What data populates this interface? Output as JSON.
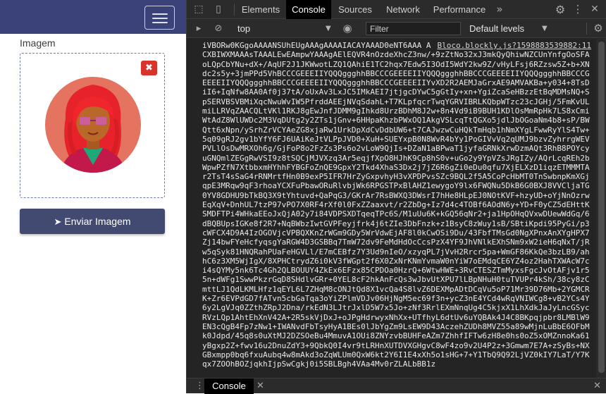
{
  "app": {
    "image_label": "Imagem",
    "remove_glyph": "✖",
    "send_button_label": "Enviar Imagem",
    "send_icon": "paper-plane-icon",
    "navbar_color": "#3a4279",
    "button_color": "#434a72",
    "remove_color": "#d9342b"
  },
  "devtools": {
    "tabs": [
      "Elements",
      "Console",
      "Sources",
      "Network",
      "Performance"
    ],
    "active_tab": "Console",
    "more_tabs_glyph": "»",
    "context": "top",
    "filter_placeholder": "Filter",
    "levels": "Default levels",
    "drawer_tab": "Console",
    "log": {
      "source": "Bloco.blockly.js?1598883539882:11",
      "text": "iVBORw0KGgoAAAANSUhEUgAAAgAAAAIACAYAAAD0eNT6AAA ACXBIWXMAAAsTAAALEwEAmpwYAAAgAElEQVR4nOzdeXhcZ3nw/+9zZtNo32xJ3mkQyQhiwNZCUnYnfgOoSFAoLQpCbYNu+dX+/AqUF2J1JKWwotLZQ1QAhiE1TC2hqx7Edw5I3OdI5WdY2kw9Z/vHyLFsj6RZzsw5Z+b+XNdc2s5y+3jmPPd5VhBCCCGEEEIIYQQQggghhBBCCCGEEEEIIYQQQggghhBBCCCGEEEEIIYQQQggghhBBCCCGEEEEIIYQQQggghhBBCCCGEEEEIIYQQQggghhBBCCCGEEEEIIYvXD2R2AEMJaGrxAE9AMVAKBa+y034+8TsDiI6+IqNfw8AA0Af0j37tA/oUxAv3LxJC5IMkAEI7jtjgcDYwC5gGtIy+xn+YgiZcaSeHBzzEtBqMDMsNQ+SpSERVBSVBMiXqcNwuWvIW5PfrddAEEjNVqSdahL+T7KLpfqcrTwqYGRVIBRLKQbpWTzc23cJGHj/5FmKvULmiLLRVqZAACQLtVKl1RKJ8gEwJnfJDMM9gIhkd8UrzBDhM8J2w+8n4Vd9iB9BUH1KDlOsMmRpHk7LS8xCmiWtAdZ8WlUWDc2M3VqDUtg2y2ZTs1jGnv+6HHpaKhzbPWxOQ1AkgVSLcqTtQGXo5jdlJbOGoaNm4b8+sP/BWQtt6xNpn/ySrhZrVCYAeZG8xjaRw1UrkDpXdCvDdbUW6+t7CAJwzwCuHQkTmHqb1hNmXYgLFwwRyYlS4Tw+5q09gRJ2gv1bYfY6FJ6UAiKeJtVLPpJVD0+XuH+SUEYxpB0N8WvR4bYy1PoGIVvVq2qUMJ9bzvZyhrrgWEVPVLlOsDwMRXOh6g/GjFoP8o2FzZs3Ps6o2vLoW9QjIs+DZaN1aBPwaT1jyfaGRNkXrwDzmAQt3RhB8POYcyuGNQmlZEGgRwVSI9z8tSQCjMJVXzq3Ar5eqjfXpO8HJhK9Cp8hS0v+uGo2y9YpVZsJRgIZy/AQrLcqREh2bWpwPZfN7XtbbxmHYhhFYBGFoZnQE9GpxY2Tkd4XhaS3Dx2j7jZ6R6gZi0eDu0qfu7XjELXzD1iqzETMMMTAr2TsT4sSaG4rRNMrtfHn0B9exP5IFR7HrZyGxpvhyH3vXPDPvsSZc9BQL2f5A5CoPcHbMT0TnSwbnpKmXGjqpE3MRqw9qF3rhoaYCXFuPbawORuRlvbjWk6RPGSTPxBlAHZ1ewygoY9lx6FWQNu5DkB6G0BXJ8VVCljaTG0YV8GDHU9bTkBQ3X9tYhtuvd+QaPqG3/GKrAr7RsBWXQ3DWsrI7hHe8HLpEJ0NOtKVF+hzyUD+oYjNnOzrwEqXqV+DnhUL7tzP97vPO7X0RF4rXf0l0FxZZaaxvt/r2ZbDg+Iz7d4c4TOBf6AOdN6y+YD+F0yCZ5dEHttKSMDFTPi4WHkaEEoJxQjA02y7i84VDPSXDTqeqTPc6S/M1uUu6K+kGQ56qNr2+ja1HpOHqQVxwDUewWdGq/6dBQBUpsIGKe8f2R7+NqBWbzIwtGVPFeyjfrk4j6tZIe3DbFnzk+z1BsyC8zWuy1sB/SBtiKpdi95PyGi/p3cWFCX4D9A4IzOGOVjcVPBQXKnZrWGm9GDy5WrVdwEjAF8l0kCwOSi9Du/43FbfTMsGd0NgXPnxAnXYgHPX7Zj14bwFYeHcfyqsgYaRGW4D3GSBBq7TmW72dv9FeMdHdOcCcsPzX4YF9JhVNlkEXhSNm9xW2ieH6qNxT/jRw5qSyk81HNQRahPUaFeHGVLl/E7mCEBfz7Y3Ud9nIeO/xzyqPL7jVvH2Rrcr5pa+WmGF86KkQe3bzLB9/ahhC6z3XM5WjIgX/8XPHCtrydZ6i0kV3fWGpt2f6X0ZxNrKNmYvmaW0nYiW7oEMdqCE6YZ4oz2HahTXWAcW7ci4sQYMy5nk6Tc4Gh2QLBOUUY4ZkEx6EFzx85CPDOa0HzrQ+6WtwHWE+3RvCTESZTmMyxsFgcJvOtAFjv1r55n+dWFg1SwwPkzrGqD8SHdlvGRr+0YEL8cF2hkAnFcQs3wJbvUtXPU7lLBpNHuH0tuTVUPr4kSh/38cy8zCmttLJ1QdLKMLHfz1qEYL6L7ZHqM8cONJtQd8X1vcQa4S8lvZ6DEXMpADtDCqVu5oP71Mr39D76Mb+2YGMCRK+Zr6EVPdGD7fATvn5cbGaTqa3oYiZPlmVDJv06HjNgM5ec69f3n+ycZ3nE4YCd4wRqVNIWCg8+vB2YCs4Y6y2LgVJq0ZZthZRpJ2Dna/rkEdN3LJtrJxlD5W7x5Jo+zNf3RrlEXmNnqUg4C5kjxX1LhXdkJaJyLncGSycRVzLQp1AhtEhXnV42A+2R5skVjDxJ+oJPgHdrwyxNhXx+UTfhyL6dtUv6uYQBAk4J4C8BKpqjpbr8LMBlW9EN3cQgB4Fp7zNw1+IWANvdFbTsyHyA1BEs0lJbYgZm9LsEW9D43AczehZUDh8MVZ55a89wMjnLuBbE6OFbMk0Jdpd/45q8s0uXtMJ2DZSOeBu4MmuvA1OUi8ZNYzvbBUHFeAZm7ZhhfIFTw6zH8e0hs0oZ5xOMZnnoKa61yBgxp2Z+fwv16u2DnuZdY3+9QbkQ0I4vr9tLRHnXUTDVXGHgvC8wF4zo9v2U4P2z+3Gmwm7E7A+zSyBs+NXGBxmpp0bq6fxuAubq4w8mAkd3oZqWLUm0QxW6kt2Y6I1E4xXh5o1sHG+7+Y1TbQ9Q92LjVZ0kIY7LaT/Y7Kqx7ZOOhBOZjqkhIjpSwCgkj0i5SBLBgh4VAa4Mv0rZLALbBB1z"
    }
  }
}
